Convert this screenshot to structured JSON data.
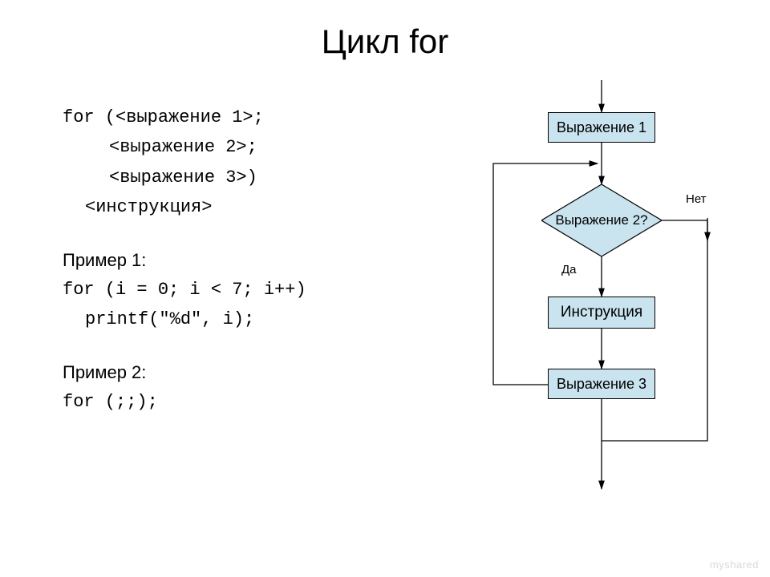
{
  "title": "Цикл for",
  "code": {
    "syntax_line1": "for (<выражение 1>;",
    "syntax_line2": "<выражение 2>;",
    "syntax_line3": "<выражение 3>)",
    "syntax_line4": "<инструкция>",
    "example1_label": "Пример 1:",
    "example1_line1": "for (i = 0; i < 7; i++)",
    "example1_line2": "printf(\"%d\", i);",
    "example2_label": "Пример 2:",
    "example2_line1": "for (;;);"
  },
  "flow": {
    "expr1": "Выражение 1",
    "cond": "Выражение 2?",
    "instr": "Инструкция",
    "expr3": "Выражение 3",
    "yes": "Да",
    "no": "Нет"
  },
  "watermark": "myshared",
  "colors": {
    "box_fill": "#c9e3ef",
    "stroke": "#000000"
  }
}
